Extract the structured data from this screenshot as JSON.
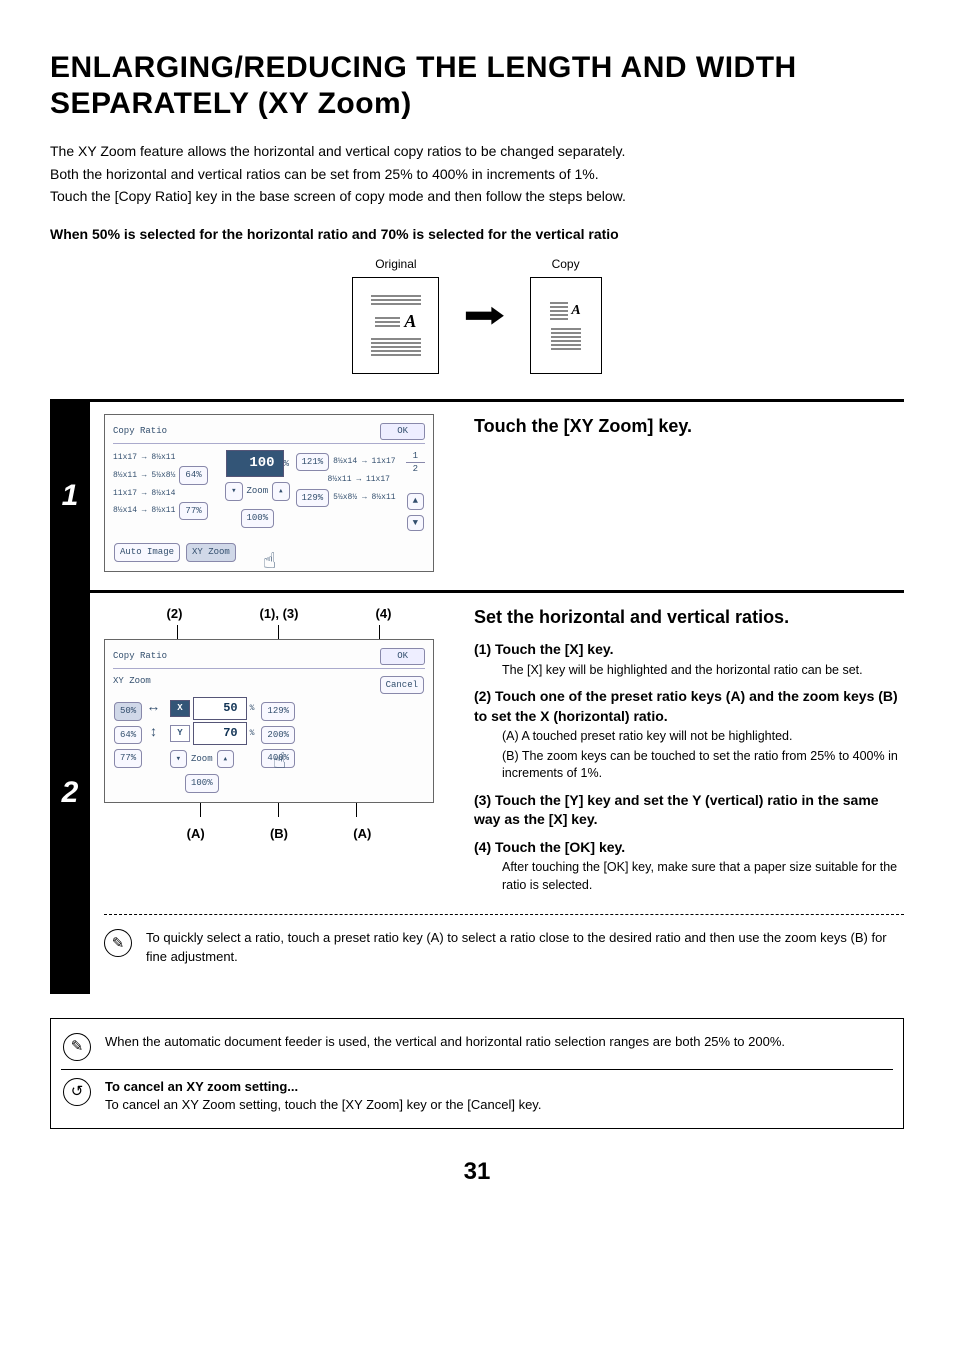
{
  "title": "ENLARGING/REDUCING THE LENGTH AND WIDTH SEPARATELY (XY Zoom)",
  "intro": {
    "p1": "The XY Zoom feature allows the horizontal and vertical copy ratios to be changed separately.",
    "p2": "Both the horizontal and vertical ratios can be set from 25% to 400% in increments of 1%.",
    "p3": "Touch the [Copy Ratio] key in the base screen of copy mode and then follow the steps below."
  },
  "example_line": "When 50% is selected for the horizontal ratio and 70% is selected for the vertical ratio",
  "diagram": {
    "original": "Original",
    "copy": "Copy"
  },
  "step1": {
    "num": "1",
    "title": "Touch the [XY Zoom] key.",
    "lcd": {
      "title": "Copy Ratio",
      "ok": "OK",
      "left_rows": [
        {
          "text": "11x17 → 8½x11",
          "pct": "64%"
        },
        {
          "text": "8½x11 → 5½x8½",
          "pct": ""
        },
        {
          "text": "11x17 → 8½x14",
          "pct": "77%"
        },
        {
          "text": "8½x14 → 8½x11",
          "pct": ""
        }
      ],
      "center_value": "100",
      "center_unit": "%",
      "zoom_label": "Zoom",
      "hundred": "100%",
      "right_rows": [
        {
          "pct": "121%",
          "text": "8½x14 → 11x17"
        },
        {
          "pct": "",
          "text": "8½x11 → 11x17"
        },
        {
          "pct": "129%",
          "text": "5½x8½ → 8½x11"
        }
      ],
      "page_ind": [
        "1",
        "2"
      ],
      "auto_image": "Auto Image",
      "xy_zoom": "XY Zoom"
    }
  },
  "step2": {
    "num": "2",
    "callouts_top": [
      "(2)",
      "(1), (3)",
      "(4)"
    ],
    "callouts_bottom": [
      "(A)",
      "(B)",
      "(A)"
    ],
    "title": "Set the horizontal and vertical ratios.",
    "lcd": {
      "title": "Copy Ratio",
      "subtitle": "XY Zoom",
      "ok": "OK",
      "cancel": "Cancel",
      "x_label": "X",
      "x_val": "50",
      "y_label": "Y",
      "y_val": "70",
      "presets_left": [
        "50%",
        "64%",
        "77%"
      ],
      "presets_right": [
        "129%",
        "200%",
        "400%"
      ],
      "zoom_label": "Zoom",
      "hundred": "100%"
    },
    "sub1_head": "(1)  Touch the [X] key.",
    "sub1_body": "The [X] key will be highlighted and the horizontal ratio can be set.",
    "sub2_head": "(2)  Touch one of the preset ratio keys (A) and the zoom keys (B) to set the X (horizontal) ratio.",
    "sub2_a": "(A)  A touched preset ratio key will not be highlighted.",
    "sub2_b": "(B)  The zoom keys can be touched to set the ratio from 25% to 400% in increments of 1%.",
    "sub3_head": "(3)  Touch the [Y] key and set the Y (vertical) ratio in the same way as the [X] key.",
    "sub4_head": "(4)  Touch the [OK] key.",
    "sub4_body": "After touching the [OK] key, make sure that a paper size suitable for the ratio is selected.",
    "tip": "To quickly select a ratio, touch a preset ratio key (A) to select a ratio close to the desired ratio and then use the zoom keys (B) for fine adjustment."
  },
  "note_box": {
    "line1": "When the automatic document feeder is used, the vertical and horizontal ratio selection ranges are both 25% to 200%.",
    "cancel_head": "To cancel an XY zoom setting...",
    "cancel_body": "To cancel an XY Zoom setting, touch the [XY Zoom] key or the [Cancel] key."
  },
  "page_number": "31"
}
